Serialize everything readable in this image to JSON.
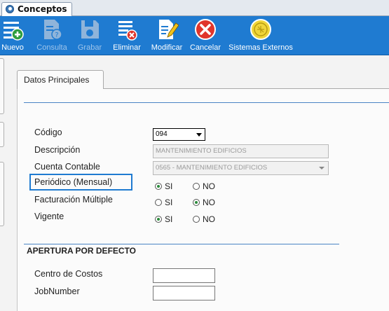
{
  "window": {
    "tab_title": "Conceptos"
  },
  "toolbar": {
    "buttons": [
      {
        "label": "Nuevo",
        "icon": "new-icon",
        "enabled": true
      },
      {
        "label": "Consulta",
        "icon": "consult-icon",
        "enabled": false
      },
      {
        "label": "Grabar",
        "icon": "save-icon",
        "enabled": false
      },
      {
        "label": "Eliminar",
        "icon": "delete-icon",
        "enabled": true
      },
      {
        "label": "Modificar",
        "icon": "edit-icon",
        "enabled": true
      },
      {
        "label": "Cancelar",
        "icon": "cancel-icon",
        "enabled": true
      },
      {
        "label": "Sistemas Externos",
        "icon": "external-systems-icon",
        "enabled": true
      }
    ]
  },
  "form": {
    "tab_label": "Datos Principales",
    "codigo": {
      "label": "Código",
      "value": "094"
    },
    "descripcion": {
      "label": "Descripción",
      "value": "MANTENIMIENTO EDIFICIOS"
    },
    "cuenta_contable": {
      "label": "Cuenta Contable",
      "value": "0565 - MANTENIMIENTO EDIFICIOS"
    },
    "periodico": {
      "label": "Periódico (Mensual)",
      "selected": "SI"
    },
    "facturacion": {
      "label": "Facturación Múltiple",
      "selected": "NO"
    },
    "vigente": {
      "label": "Vigente",
      "selected": "SI"
    },
    "radio_yes": "SI",
    "radio_no": "NO"
  },
  "apertura": {
    "title": "APERTURA POR DEFECTO",
    "centro_costos": {
      "label": "Centro de Costos",
      "value": ""
    },
    "jobnumber": {
      "label": "JobNumber",
      "value": ""
    }
  },
  "colors": {
    "toolbar": "#1f7bd1",
    "highlight": "#1f7bd1",
    "cancel": "#e0352b"
  }
}
